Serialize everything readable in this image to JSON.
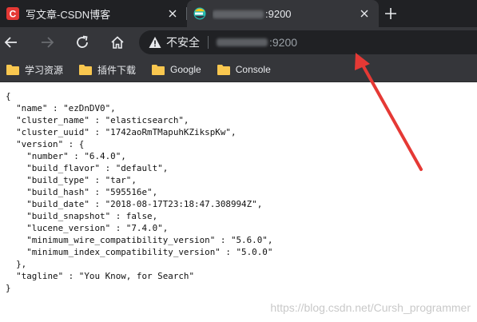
{
  "tabs": [
    {
      "title": "写文章-CSDN博客",
      "active": false,
      "favicon": "csdn-c-icon"
    },
    {
      "title": ":9200",
      "active": true,
      "favicon": "elasticsearch-icon",
      "title_partially_obscured": true
    }
  ],
  "toolbar": {
    "security_label": "不安全",
    "url": ":9200",
    "url_partially_obscured": true
  },
  "bookmarks": [
    {
      "label": "学习资源",
      "icon": "folder-icon"
    },
    {
      "label": "插件下载",
      "icon": "folder-icon"
    },
    {
      "label": "Google",
      "icon": "folder-icon"
    },
    {
      "label": "Console",
      "icon": "folder-icon"
    }
  ],
  "content": {
    "json_lines": [
      "{",
      "  \"name\" : \"ezDnDV0\",",
      "  \"cluster_name\" : \"elasticsearch\",",
      "  \"cluster_uuid\" : \"1742aoRmTMapuhKZikspKw\",",
      "  \"version\" : {",
      "    \"number\" : \"6.4.0\",",
      "    \"build_flavor\" : \"default\",",
      "    \"build_type\" : \"tar\",",
      "    \"build_hash\" : \"595516e\",",
      "    \"build_date\" : \"2018-08-17T23:18:47.308994Z\",",
      "    \"build_snapshot\" : false,",
      "    \"lucene_version\" : \"7.4.0\",",
      "    \"minimum_wire_compatibility_version\" : \"5.6.0\",",
      "    \"minimum_index_compatibility_version\" : \"5.0.0\"",
      "  },",
      "  \"tagline\" : \"You Know, for Search\"",
      "}"
    ]
  },
  "watermark": "https://blog.csdn.net/Cursh_programmer",
  "colors": {
    "tabstrip_bg": "#202124",
    "toolbar_bg": "#35363a",
    "omnibox_bg": "#202124",
    "text_light": "#e8eaed",
    "folder": "#f9c74f",
    "annotation_arrow": "#e53935",
    "csdn_red": "#e53935"
  }
}
